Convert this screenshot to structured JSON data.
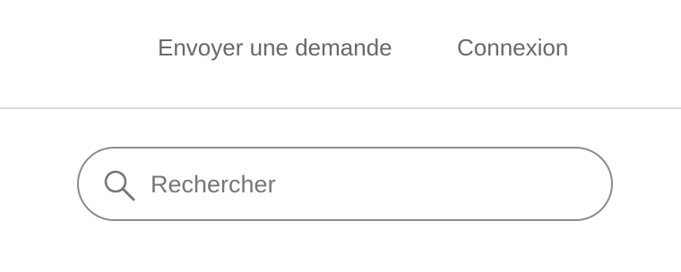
{
  "nav": {
    "request_label": "Envoyer une demande",
    "login_label": "Connexion"
  },
  "search": {
    "placeholder": "Rechercher",
    "value": "",
    "icon": "search-icon"
  },
  "colors": {
    "nav_text": "#68696b",
    "divider": "#dadada",
    "search_border": "#8b8c8e",
    "placeholder": "#757679"
  }
}
